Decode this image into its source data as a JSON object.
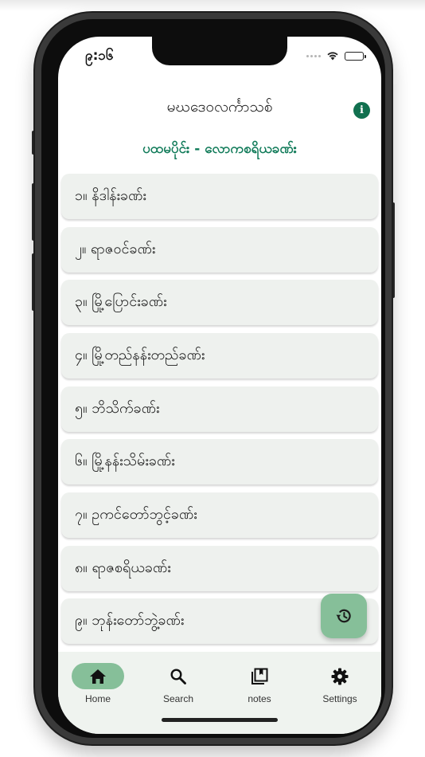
{
  "status_bar": {
    "time": "၉:၁၆"
  },
  "header": {
    "title": "မဃဒေဝလင်္ကာသစ်",
    "info_icon": "info-icon",
    "info_glyph": "i"
  },
  "section": {
    "heading": "ပထမပိုင်း - လောကစရိယခဏ်း"
  },
  "chapters": [
    {
      "label": "၁။ နိဒါန်းခဏ်း"
    },
    {
      "label": "၂။ ရာဇဝင်ခဏ်း"
    },
    {
      "label": "၃။ မြို့ပြောင်းခဏ်း"
    },
    {
      "label": "၄။ မြို့တည်နန်းတည်ခဏ်း"
    },
    {
      "label": "၅။ ဘိသိက်ခဏ်း"
    },
    {
      "label": "၆။ မြို့နန်းသိမ်းခဏ်း"
    },
    {
      "label": "၇။ ဥကင်တော်ဘွင့်ခဏ်း"
    },
    {
      "label": "၈။ ရာဇစရိယခဏ်း"
    },
    {
      "label": "၉။ ဘုန်းတော်ဘွဲ့ခဏ်း"
    }
  ],
  "fab": {
    "icon": "history-icon"
  },
  "bottom_nav": {
    "items": [
      {
        "label": "Home",
        "icon": "home-icon",
        "active": true
      },
      {
        "label": "Search",
        "icon": "search-icon",
        "active": false
      },
      {
        "label": "notes",
        "icon": "notes-icon",
        "active": false
      },
      {
        "label": "Settings",
        "icon": "gear-icon",
        "active": false
      }
    ]
  },
  "colors": {
    "accent": "#11704f",
    "heading": "#0f7a58",
    "active_pill": "#86bf99",
    "card_bg": "#eef1ee",
    "nav_bg": "#eff3ef"
  }
}
